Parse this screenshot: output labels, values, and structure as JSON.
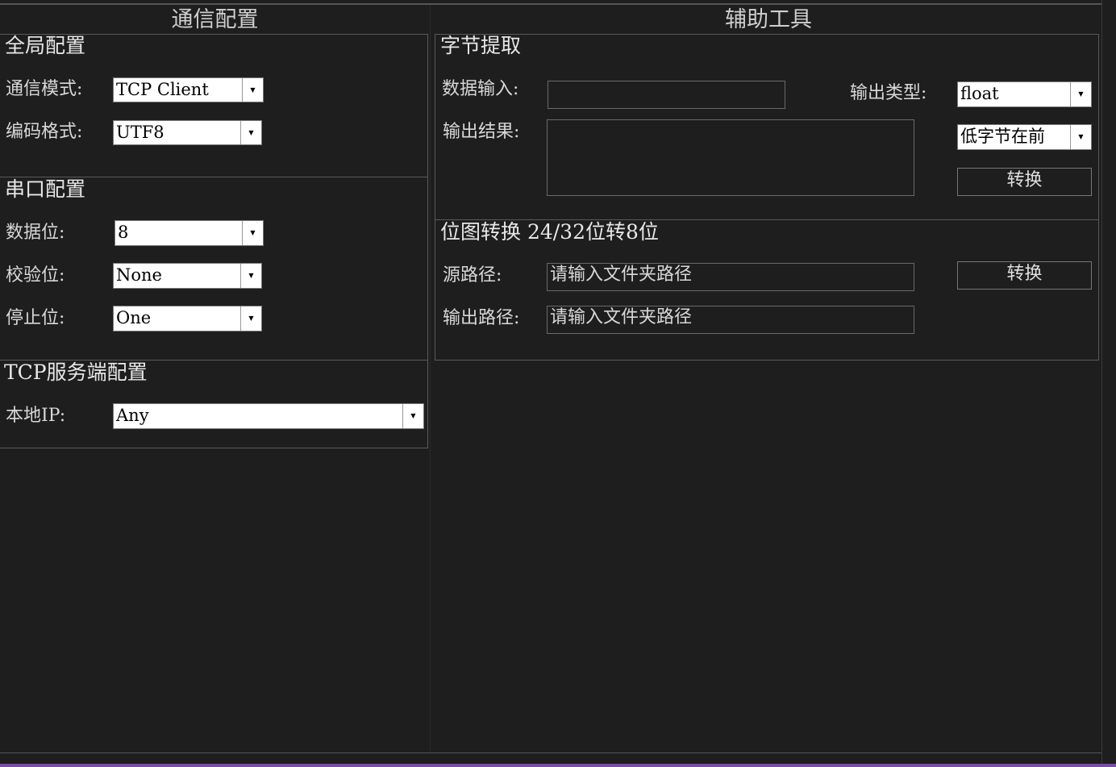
{
  "columns": {
    "left_title": "通信配置",
    "right_title": "辅助工具"
  },
  "global_config": {
    "title": "全局配置",
    "comm_mode_label": "通信模式:",
    "comm_mode_value": "TCP Client",
    "encoding_label": "编码格式:",
    "encoding_value": "UTF8"
  },
  "serial_config": {
    "title": "串口配置",
    "data_bits_label": "数据位:",
    "data_bits_value": "8",
    "parity_label": "校验位:",
    "parity_value": "None",
    "stop_bits_label": "停止位:",
    "stop_bits_value": "One"
  },
  "tcp_server_config": {
    "title": "TCP服务端配置",
    "local_ip_label": "本地IP:",
    "local_ip_value": "Any"
  },
  "byte_extract": {
    "title": "字节提取",
    "data_input_label": "数据输入:",
    "data_input_value": "",
    "output_result_label": "输出结果:",
    "output_result_value": "",
    "output_type_label": "输出类型:",
    "output_type_value": "float",
    "byte_order_value": "低字节在前",
    "convert_label": "转换"
  },
  "bitmap_convert": {
    "title": "位图转换 24/32位转8位",
    "source_path_label": "源路径:",
    "source_path_placeholder": "请输入文件夹路径",
    "output_path_label": "输出路径:",
    "output_path_placeholder": "请输入文件夹路径",
    "convert_label": "转换"
  },
  "icons": {
    "dropdown": "chevron-down-icon"
  }
}
